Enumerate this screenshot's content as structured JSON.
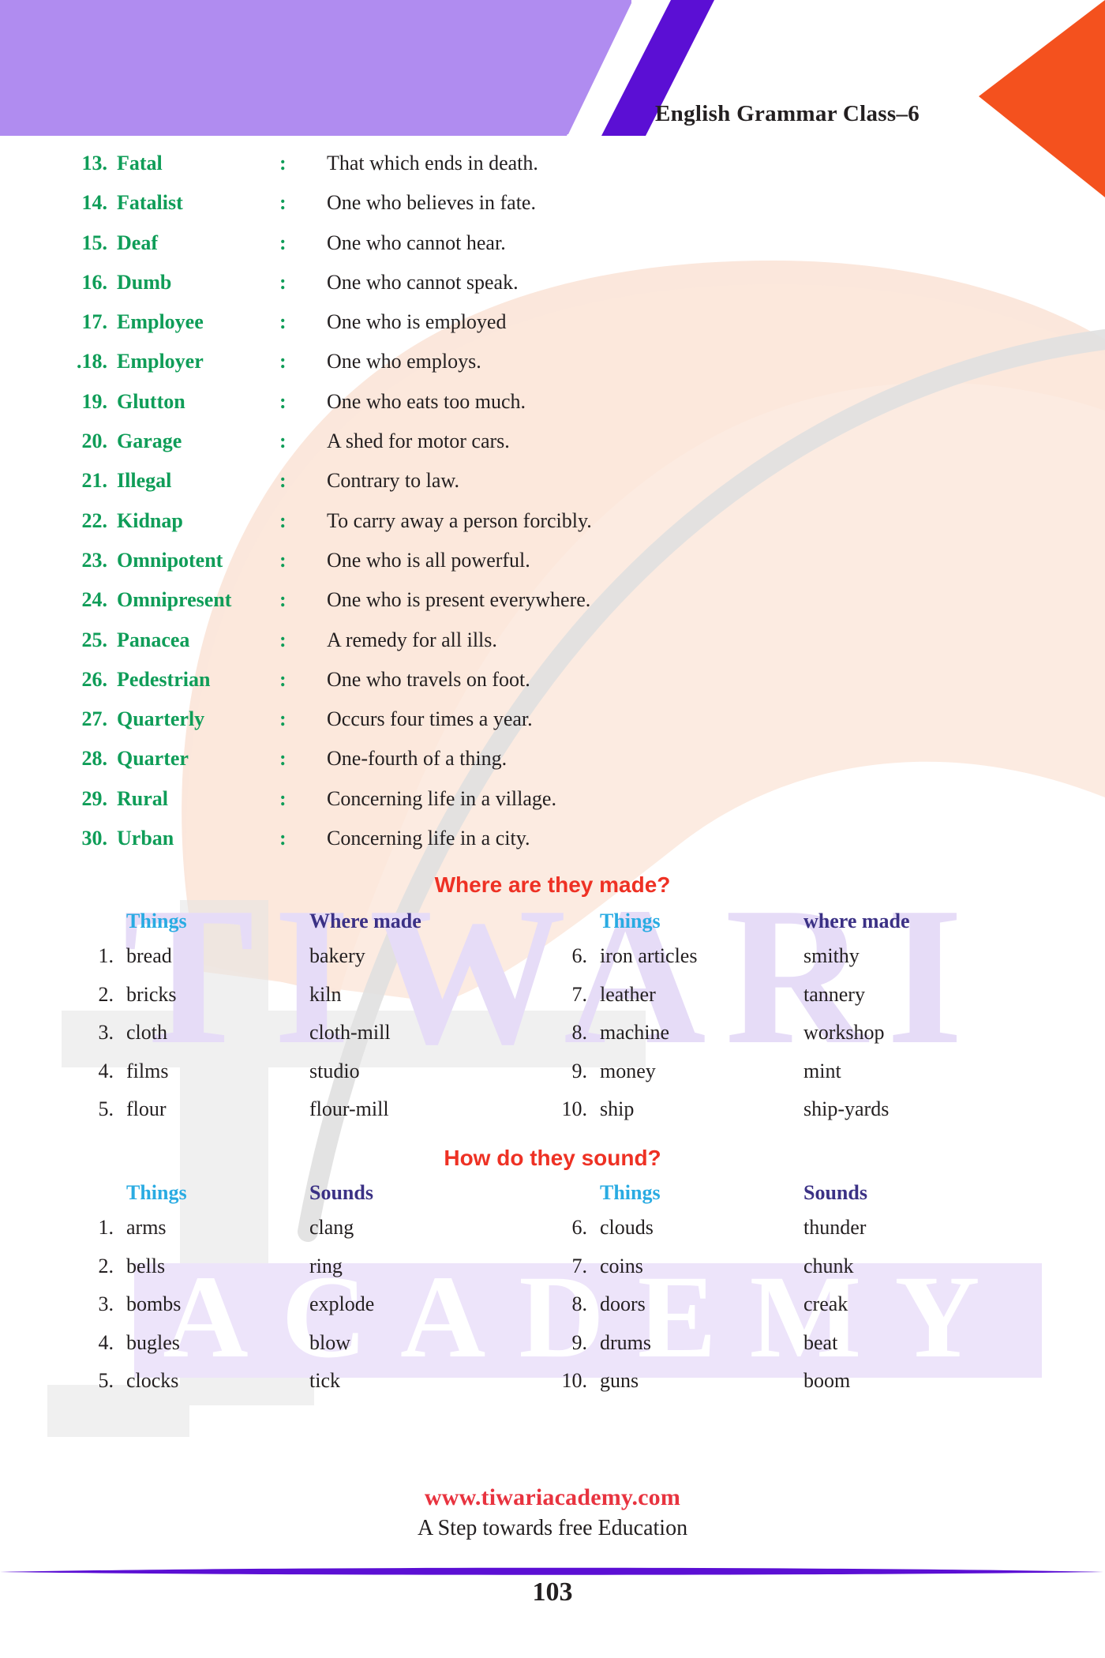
{
  "header": {
    "title": "English Grammar Class–6"
  },
  "definitions": {
    "items": [
      {
        "num": "13.",
        "word": "Fatal",
        "colon": ":",
        "meaning": "That which ends in death."
      },
      {
        "num": "14.",
        "word": "Fatalist",
        "colon": ":",
        "meaning": "One who believes in fate."
      },
      {
        "num": "15.",
        "word": "Deaf",
        "colon": ":",
        "meaning": "One who cannot hear."
      },
      {
        "num": "16.",
        "word": "Dumb",
        "colon": ":",
        "meaning": "One who cannot speak."
      },
      {
        "num": "17.",
        "word": "Employee",
        "colon": ":",
        "meaning": "One who is employed"
      },
      {
        "num": ".18.",
        "word": "Employer",
        "colon": ":",
        "meaning": "One who employs."
      },
      {
        "num": "19.",
        "word": "Glutton",
        "colon": ":",
        "meaning": "One who eats too much."
      },
      {
        "num": "20.",
        "word": "Garage",
        "colon": ":",
        "meaning": "A shed for motor cars."
      },
      {
        "num": "21.",
        "word": "Illegal",
        "colon": ":",
        "meaning": "Contrary to law."
      },
      {
        "num": "22.",
        "word": "Kidnap",
        "colon": ":",
        "meaning": "To carry away a person forcibly."
      },
      {
        "num": "23.",
        "word": "Omnipotent",
        "colon": ":",
        "meaning": "One who is all powerful."
      },
      {
        "num": "24.",
        "word": "Omnipresent",
        "colon": ":",
        "meaning": "One who is present everywhere."
      },
      {
        "num": "25.",
        "word": "Panacea",
        "colon": ":",
        "meaning": "A remedy for all ills."
      },
      {
        "num": "26.",
        "word": "Pedestrian",
        "colon": ":",
        "meaning": "One who travels on foot."
      },
      {
        "num": "27.",
        "word": "Quarterly",
        "colon": ":",
        "meaning": "Occurs four times a year."
      },
      {
        "num": "28.",
        "word": "Quarter",
        "colon": ":",
        "meaning": "One-fourth of a thing."
      },
      {
        "num": "29.",
        "word": "Rural",
        "colon": ":",
        "meaning": "Concerning life in a village."
      },
      {
        "num": "30.",
        "word": "Urban",
        "colon": ":",
        "meaning": "Concerning life in a city."
      }
    ]
  },
  "where_made": {
    "heading": "Where are they made?",
    "headers": {
      "left_things": "Things",
      "left_value": "Where made",
      "right_things": "Things",
      "right_value": "where made"
    },
    "rows": [
      {
        "ln": "1.",
        "lthing": "bread",
        "lvalue": "bakery",
        "rn": "6.",
        "rthing": "iron articles",
        "rvalue": "smithy"
      },
      {
        "ln": "2.",
        "lthing": "bricks",
        "lvalue": "kiln",
        "rn": "7.",
        "rthing": "leather",
        "rvalue": "tannery"
      },
      {
        "ln": "3.",
        "lthing": "cloth",
        "lvalue": "cloth-mill",
        "rn": "8.",
        "rthing": "machine",
        "rvalue": "workshop"
      },
      {
        "ln": "4.",
        "lthing": "films",
        "lvalue": "studio",
        "rn": "9.",
        "rthing": "money",
        "rvalue": "mint"
      },
      {
        "ln": "5.",
        "lthing": "flour",
        "lvalue": "flour-mill",
        "rn": "10.",
        "rthing": "ship",
        "rvalue": "ship-yards"
      }
    ]
  },
  "how_sound": {
    "heading": "How do they sound?",
    "headers": {
      "left_things": "Things",
      "left_value": "Sounds",
      "right_things": "Things",
      "right_value": "Sounds"
    },
    "rows": [
      {
        "ln": "1.",
        "lthing": "arms",
        "lvalue": "clang",
        "rn": "6.",
        "rthing": "clouds",
        "rvalue": "thunder"
      },
      {
        "ln": "2.",
        "lthing": "bells",
        "lvalue": "ring",
        "rn": "7.",
        "rthing": "coins",
        "rvalue": "chunk"
      },
      {
        "ln": "3.",
        "lthing": "bombs",
        "lvalue": "explode",
        "rn": "8.",
        "rthing": "doors",
        "rvalue": "creak"
      },
      {
        "ln": "4.",
        "lthing": "bugles",
        "lvalue": "blow",
        "rn": "9.",
        "rthing": "drums",
        "rvalue": "beat"
      },
      {
        "ln": "5.",
        "lthing": "clocks",
        "lvalue": "tick",
        "rn": "10.",
        "rthing": "guns",
        "rvalue": "boom"
      }
    ]
  },
  "watermark": {
    "line1": "TIWARI",
    "line2": "ACADEMY"
  },
  "footer": {
    "site": "www.tiwariacademy.com",
    "tagline": "A Step towards free Education",
    "page_number": "103"
  },
  "colors": {
    "green": "#0F9D58",
    "red_heading": "#EE3124",
    "cyan_header": "#29ABE2",
    "indigo_header": "#3B3185",
    "light_purple": "#B08CF0",
    "deep_purple": "#5B0FD4",
    "orange": "#F4511E",
    "footer_red": "#E8333F",
    "peach_leaf": "#FBE7DC",
    "watermark_purple": "#E6DCF7",
    "watermark_gray": "#E4E4E4"
  }
}
